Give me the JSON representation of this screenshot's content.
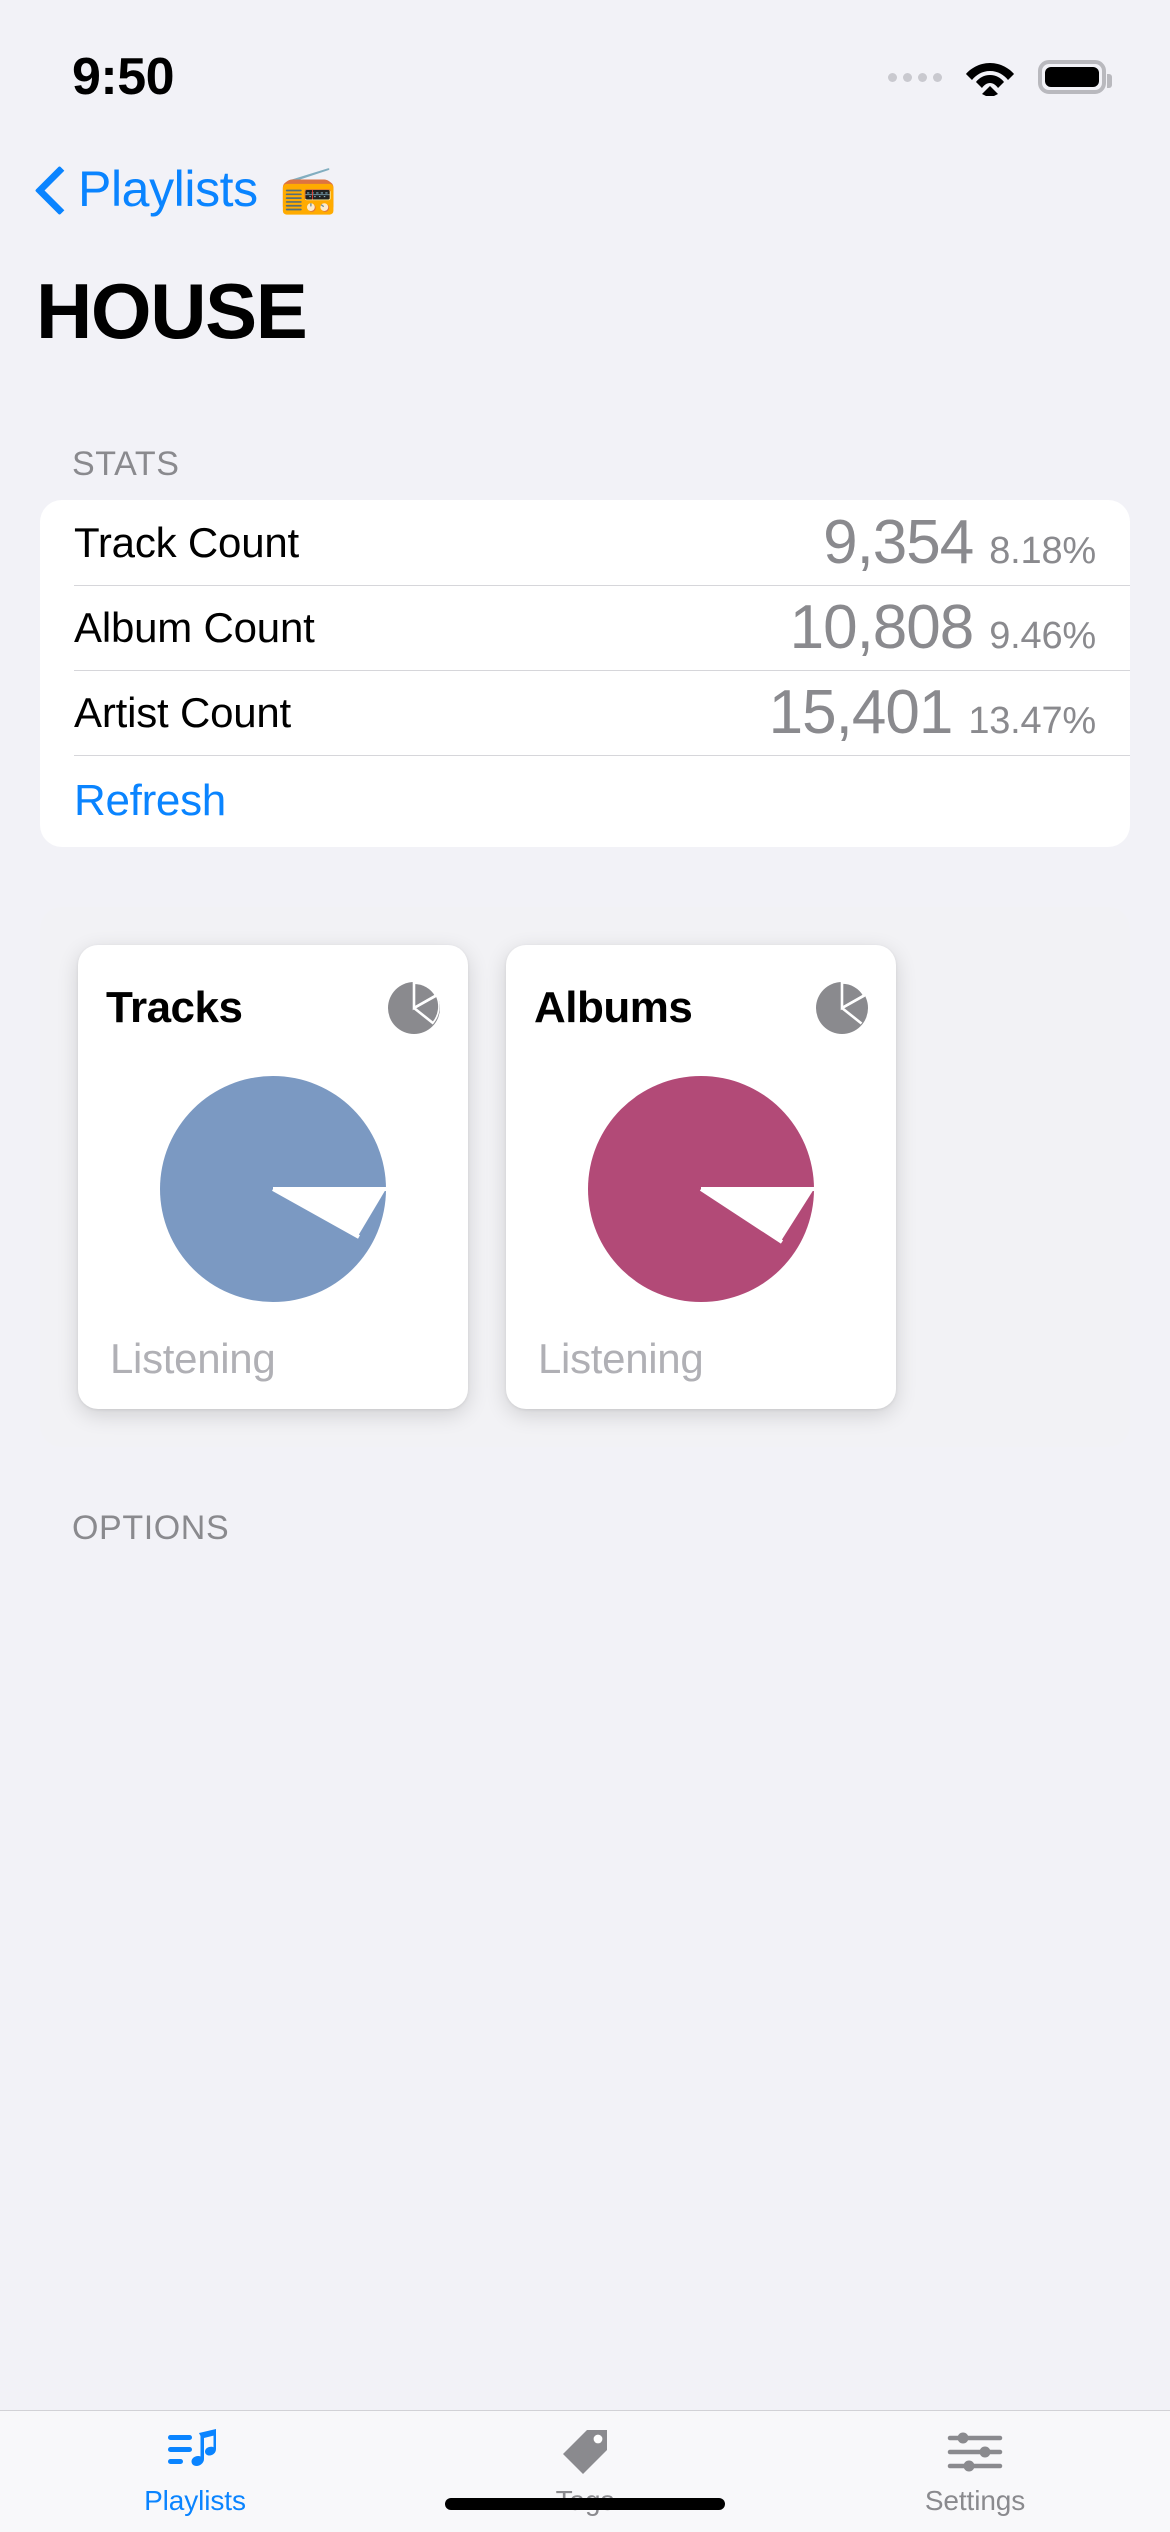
{
  "status_bar": {
    "time": "9:50",
    "signal_icon": "signal-dots-icon",
    "wifi_icon": "wifi-icon",
    "battery_icon": "battery-full-icon",
    "battery_level_pct": 100
  },
  "nav": {
    "back_icon": "chevron-left-icon",
    "back_label": "Playlists",
    "back_emoji": "📻"
  },
  "page_title": "HOUSE",
  "stats": {
    "section_header": "STATS",
    "rows": [
      {
        "label": "Track Count",
        "value": "9,354",
        "percent": "8.18%"
      },
      {
        "label": "Album Count",
        "value": "10,808",
        "percent": "9.46%"
      },
      {
        "label": "Artist Count",
        "value": "15,401",
        "percent": "13.47%"
      }
    ],
    "refresh_label": "Refresh"
  },
  "charts": [
    {
      "title": "Tracks",
      "icon": "pie-chart-icon",
      "footer": "Listening",
      "color": "#7b99c2"
    },
    {
      "title": "Albums",
      "icon": "pie-chart-icon",
      "footer": "Listening",
      "color": "#b24a77"
    }
  ],
  "options": {
    "section_header": "OPTIONS"
  },
  "tab_bar": {
    "items": [
      {
        "label": "Playlists",
        "icon": "music-note-list-icon",
        "active": true
      },
      {
        "label": "Tags",
        "icon": "tag-icon",
        "active": false
      },
      {
        "label": "Settings",
        "icon": "sliders-icon",
        "active": false
      }
    ]
  },
  "colors": {
    "accent": "#0a84ff",
    "background": "#f2f2f7",
    "card": "#ffffff",
    "secondary_text": "#8a8a8e",
    "tracks_slice": "#7b99c2",
    "albums_slice": "#b24a77"
  },
  "chart_data": [
    {
      "type": "pie",
      "title": "Tracks",
      "footer_label": "Listening",
      "categories": [
        "Listening",
        "Remaining"
      ],
      "values": [
        91.82,
        8.18
      ],
      "colors": [
        "#7b99c2",
        "#ffffff"
      ],
      "legend": "none",
      "grid": false
    },
    {
      "type": "pie",
      "title": "Albums",
      "footer_label": "Listening",
      "categories": [
        "Listening",
        "Remaining"
      ],
      "values": [
        90.54,
        9.46
      ],
      "colors": [
        "#b24a77",
        "#ffffff"
      ],
      "legend": "none",
      "grid": false
    }
  ]
}
